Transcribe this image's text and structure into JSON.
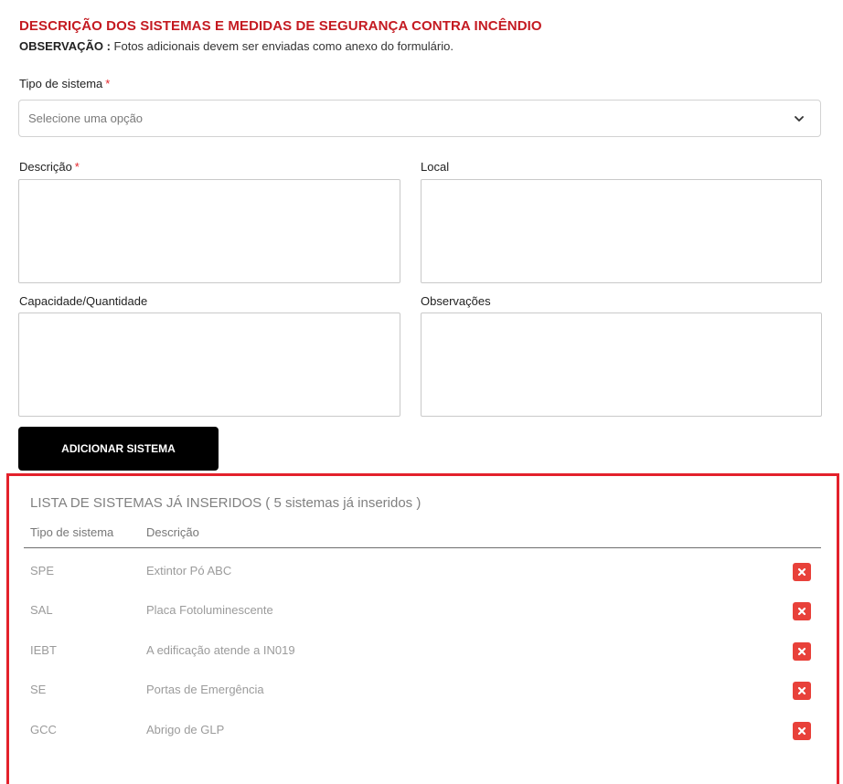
{
  "header": {
    "title": "DESCRIÇÃO DOS SISTEMAS E MEDIDAS DE SEGURANÇA CONTRA INCÊNDIO",
    "observation_label": "OBSERVAÇÃO :",
    "observation_text": "Fotos adicionais devem ser enviadas como anexo do formulário."
  },
  "form": {
    "tipo_label": "Tipo de sistema",
    "required_mark": "*",
    "tipo_placeholder": "Selecione uma opção",
    "descricao_label": "Descrição",
    "local_label": "Local",
    "capacidade_label": "Capacidade/Quantidade",
    "observacoes_label": "Observações",
    "add_button": "ADICIONAR SISTEMA"
  },
  "list": {
    "title": "LISTA DE SISTEMAS JÁ INSERIDOS ( 5 sistemas já inseridos )",
    "columns": [
      "Tipo de sistema",
      "Descrição"
    ],
    "rows": [
      {
        "tipo": "SPE",
        "descricao": "Extintor Pó ABC"
      },
      {
        "tipo": "SAL",
        "descricao": "Placa Fotoluminescente"
      },
      {
        "tipo": "IEBT",
        "descricao": "A edificação atende a IN019"
      },
      {
        "tipo": "SE",
        "descricao": "Portas de Emergência"
      },
      {
        "tipo": "GCC",
        "descricao": "Abrigo de GLP"
      }
    ],
    "delete_icon": "close-icon"
  },
  "colors": {
    "title_red": "#c41a21",
    "highlight_border": "#e3212b",
    "delete_button": "#e8413a",
    "button_black": "#000000"
  }
}
